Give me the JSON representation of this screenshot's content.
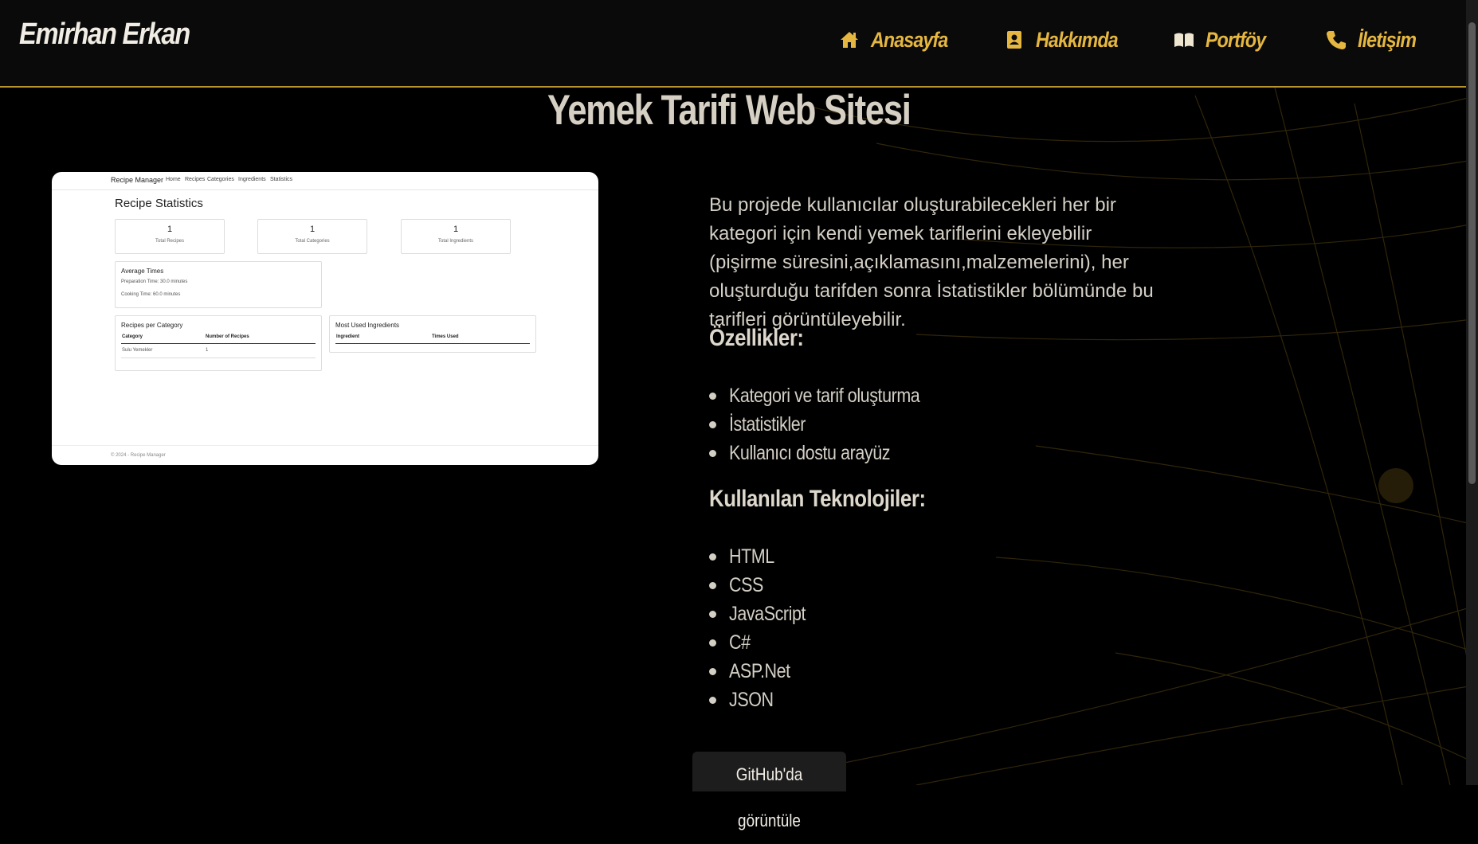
{
  "navbar": {
    "brand": "Emirhan Erkan",
    "items": [
      {
        "label": "Anasayfa",
        "icon": "home-icon"
      },
      {
        "label": "Hakkımda",
        "icon": "contact-card-icon"
      },
      {
        "label": "Portföy",
        "icon": "book-icon"
      },
      {
        "label": "İletişim",
        "icon": "phone-icon"
      }
    ]
  },
  "main": {
    "title": "Yemek Tarifi Web Sitesi",
    "description": "Bu projede kullanıcılar oluşturabilecekleri her bir kategori için kendi yemek tariflerini ekleyebilir (pişirme süresini,açıklamasını,malzemelerini), her oluşturduğu tarifden sonra İstatistikler bölümünde bu tarifleri görüntüleyebilir.",
    "features_heading": "Özellikler:",
    "features": [
      "Kategori ve tarif oluşturma",
      "İstatistikler",
      "Kullanıcı dostu arayüz"
    ],
    "tech_heading": "Kullanılan Teknolojiler:",
    "technologies": [
      "HTML",
      "CSS",
      "JavaScript",
      "C#",
      "ASP.Net",
      "JSON"
    ],
    "github_button": "GitHub'da görüntüle"
  },
  "screenshot": {
    "brand": "Recipe Manager",
    "nav": [
      "Home",
      "Recipes",
      "Categories",
      "Ingredients",
      "Statistics"
    ],
    "heading": "Recipe Statistics",
    "stats": [
      {
        "value": "1",
        "label": "Total Recipes"
      },
      {
        "value": "1",
        "label": "Total Categories"
      },
      {
        "value": "1",
        "label": "Total Ingredients"
      }
    ],
    "avg_title": "Average Times",
    "prep_time": "Preparation Time: 30.0 minutes",
    "cook_time": "Cooking Time: 60.0 minutes",
    "per_category_title": "Recipes per Category",
    "per_category_headers": [
      "Category",
      "Number of Recipes"
    ],
    "per_category_rows": [
      [
        "Sulu Yemekler",
        "1"
      ]
    ],
    "ingredients_title": "Most Used Ingredients",
    "ingredients_headers": [
      "Ingredient",
      "Times Used"
    ],
    "footer": "© 2024 - Recipe Manager"
  },
  "colors": {
    "accent": "#e6b740",
    "nav_border": "#b8922e",
    "background": "#000000",
    "text": "#d4cfc5"
  }
}
